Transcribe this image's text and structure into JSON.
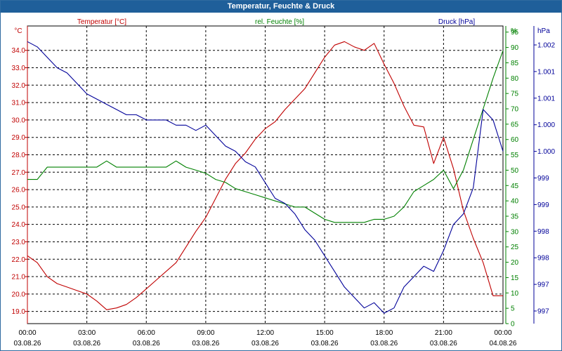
{
  "window": {
    "title": "Temperatur, Feuchte & Druck"
  },
  "chart_data": {
    "type": "line",
    "title": "Temperatur, Feuchte & Druck",
    "x_range": [
      "03.08.26 00:00",
      "04.08.26 00:00"
    ],
    "x_ticks": [
      {
        "time": "00:00",
        "date": "03.08.26"
      },
      {
        "time": "03:00",
        "date": "03.08.26"
      },
      {
        "time": "06:00",
        "date": "03.08.26"
      },
      {
        "time": "09:00",
        "date": "03.08.26"
      },
      {
        "time": "12:00",
        "date": "03.08.26"
      },
      {
        "time": "15:00",
        "date": "03.08.26"
      },
      {
        "time": "18:00",
        "date": "03.08.26"
      },
      {
        "time": "21:00",
        "date": "03.08.26"
      },
      {
        "time": "00:00",
        "date": "04.08.26"
      }
    ],
    "grid": true,
    "axes": {
      "temp": {
        "unit": "°C",
        "side": "left",
        "color": "#c00000",
        "ylim": [
          18.3,
          35.4
        ],
        "ticks": [
          "19.0",
          "20.0",
          "21.0",
          "22.0",
          "23.0",
          "24.0",
          "25.0",
          "26.0",
          "27.0",
          "28.0",
          "29.0",
          "30.0",
          "31.0",
          "32.0",
          "33.0",
          "34.0"
        ]
      },
      "hum": {
        "unit": "%",
        "side": "right",
        "color": "#008000",
        "ylim": [
          0,
          97
        ],
        "ticks": [
          "0",
          "5",
          "10",
          "15",
          "20",
          "25",
          "30",
          "35",
          "40",
          "45",
          "50",
          "55",
          "60",
          "65",
          "70",
          "75",
          "80",
          "85",
          "90",
          "95"
        ]
      },
      "press": {
        "unit": "hPa",
        "side": "right",
        "color": "#000099",
        "ylim": [
          996.6,
          1002.3
        ],
        "ticks": [
          "997",
          "997",
          "998",
          "998",
          "999",
          "999",
          "1.000",
          "1.000",
          "1.001",
          "1.001",
          "1.002"
        ]
      }
    },
    "series": [
      {
        "name": "Temperatur [°C]",
        "axis": "temp",
        "color": "#c00000",
        "x": [
          0,
          0.5,
          1,
          1.5,
          2,
          2.5,
          3,
          3.5,
          4,
          4.5,
          5,
          5.5,
          6,
          6.5,
          7,
          7.5,
          8,
          8.5,
          9,
          9.5,
          10,
          10.5,
          11,
          11.5,
          12,
          12.5,
          13,
          13.5,
          14,
          14.5,
          15,
          15.5,
          16,
          16.5,
          17,
          17.5,
          18,
          18.5,
          19,
          19.5,
          20,
          20.5,
          21,
          21.5,
          22,
          22.5,
          23,
          23.5,
          24
        ],
        "values": [
          22.2,
          21.8,
          21.0,
          20.6,
          20.4,
          20.2,
          20.0,
          19.6,
          19.1,
          19.2,
          19.4,
          19.8,
          20.3,
          20.8,
          21.3,
          21.8,
          22.7,
          23.6,
          24.4,
          25.5,
          26.6,
          27.5,
          28.1,
          28.9,
          29.5,
          29.9,
          30.6,
          31.2,
          31.8,
          32.7,
          33.6,
          34.3,
          34.5,
          34.2,
          34.0,
          34.4,
          33.2,
          32.1,
          30.8,
          29.7,
          29.6,
          27.5,
          29.0,
          27.2,
          24.8,
          23.2,
          21.8,
          19.9,
          19.9
        ]
      },
      {
        "name": "rel. Feuchte [%]",
        "axis": "hum",
        "color": "#008000",
        "x": [
          0,
          0.5,
          1,
          1.5,
          2,
          2.5,
          3,
          3.5,
          4,
          4.5,
          5,
          5.5,
          6,
          6.5,
          7,
          7.5,
          8,
          8.5,
          9,
          9.5,
          10,
          10.5,
          11,
          11.5,
          12,
          12.5,
          13,
          13.5,
          14,
          14.5,
          15,
          15.5,
          16,
          16.5,
          17,
          17.5,
          18,
          18.5,
          19,
          19.5,
          20,
          20.5,
          21,
          21.5,
          22,
          22.5,
          23,
          23.5,
          24
        ],
        "values": [
          47,
          47,
          51,
          51,
          51,
          51,
          51,
          51,
          53,
          51,
          51,
          51,
          51,
          51,
          51,
          53,
          51,
          50,
          49,
          47,
          46,
          44,
          43,
          42,
          41,
          40,
          39,
          38,
          38,
          36,
          34,
          33,
          33,
          33,
          33,
          34,
          34,
          35,
          38,
          43,
          45,
          47,
          50,
          44,
          50,
          60,
          70,
          80,
          89
        ]
      },
      {
        "name": "Druck [hPa]",
        "axis": "press",
        "color": "#000099",
        "x": [
          0,
          0.5,
          1,
          1.5,
          2,
          2.5,
          3,
          3.5,
          4,
          4.5,
          5,
          5.5,
          6,
          6.5,
          7,
          7.5,
          8,
          8.5,
          9,
          9.5,
          10,
          10.5,
          11,
          11.5,
          12,
          12.5,
          13,
          13.5,
          14,
          14.5,
          15,
          15.5,
          16,
          16.5,
          17,
          17.5,
          18,
          18.5,
          19,
          19.5,
          20,
          20.5,
          21,
          21.5,
          22,
          22.5,
          23,
          23.5,
          24
        ],
        "values": [
          1002.0,
          1001.9,
          1001.7,
          1001.5,
          1001.4,
          1001.2,
          1001.0,
          1000.9,
          1000.8,
          1000.7,
          1000.6,
          1000.6,
          1000.5,
          1000.5,
          1000.5,
          1000.4,
          1000.4,
          1000.3,
          1000.4,
          1000.2,
          1000.0,
          999.9,
          999.7,
          999.6,
          999.3,
          999.0,
          998.9,
          998.7,
          998.4,
          998.2,
          997.9,
          997.6,
          997.3,
          997.1,
          996.9,
          997.0,
          996.8,
          996.9,
          997.3,
          997.5,
          997.7,
          997.6,
          998.0,
          998.5,
          998.7,
          999.2,
          1000.7,
          1000.5,
          999.9
        ]
      }
    ]
  }
}
